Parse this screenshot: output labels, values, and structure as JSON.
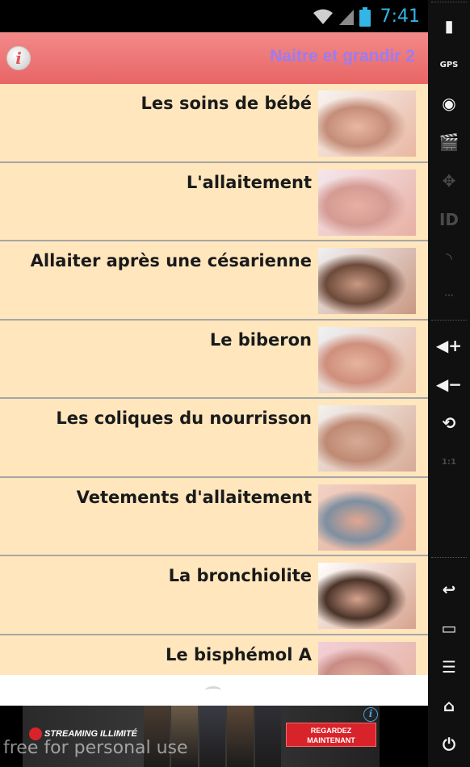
{
  "status_bar": {
    "time": "7:41"
  },
  "app_bar": {
    "title": "Naitre et grandir 2",
    "info_glyph": "i"
  },
  "list": {
    "items": [
      {
        "label": "Les soins de bébé",
        "thumb_colors": [
          "#f7f4f1",
          "#e9b7a2",
          "#c48d79"
        ]
      },
      {
        "label": "L'allaitement",
        "thumb_colors": [
          "#f4e7ee",
          "#e8b0a3",
          "#d49b93"
        ]
      },
      {
        "label": "Allaiter après une césarienne",
        "thumb_colors": [
          "#f0f0f2",
          "#c99883",
          "#6c4a3a"
        ]
      },
      {
        "label": "Le biberon",
        "thumb_colors": [
          "#eef2f6",
          "#e5b49d",
          "#cf8f7c"
        ]
      },
      {
        "label": "Les coliques du nourrisson",
        "thumb_colors": [
          "#f3f1ee",
          "#d7aa95",
          "#bf8a74"
        ]
      },
      {
        "label": "Vetements d'allaitement",
        "thumb_colors": [
          "#f1d2c4",
          "#e1a791",
          "#7e8fa1"
        ]
      },
      {
        "label": "La bronchiolite",
        "thumb_colors": [
          "#ffffff",
          "#d7a38e",
          "#4a3328"
        ]
      },
      {
        "label": "Le bisphémol A",
        "thumb_colors": [
          "#f3cfd8",
          "#e3b29f",
          "#c98c84"
        ]
      }
    ]
  },
  "ad": {
    "brand": "STREAMING ILLIMITÉ",
    "cta_line1": "REGARDEZ",
    "cta_line2": "MAINTENANT",
    "choice_glyph": "i",
    "watermark": "free for personal use",
    "poster_colors": [
      "#4a3b30",
      "#6b5a48",
      "#3b3b45",
      "#5a4636",
      "#2f2f36"
    ]
  },
  "emulator": {
    "buttons": [
      {
        "name": "battery-icon",
        "glyph": "▮"
      },
      {
        "name": "gps-icon",
        "glyph": "GPS"
      },
      {
        "name": "camera-icon",
        "glyph": "◉"
      },
      {
        "name": "video-icon",
        "glyph": "🎬"
      },
      {
        "name": "dpad-icon",
        "glyph": "✥"
      },
      {
        "name": "id-icon",
        "glyph": "ID"
      },
      {
        "name": "rss-icon",
        "glyph": "◝"
      },
      {
        "name": "sms-icon",
        "glyph": "···"
      },
      {
        "name": "volume-up-icon",
        "glyph": "◀+"
      },
      {
        "name": "volume-down-icon",
        "glyph": "◀−"
      },
      {
        "name": "rotate-icon",
        "glyph": "⟲"
      },
      {
        "name": "scale-icon",
        "glyph": "1:1"
      },
      {
        "name": "back-icon",
        "glyph": "↩"
      },
      {
        "name": "recents-icon",
        "glyph": "▭"
      },
      {
        "name": "menu-icon",
        "glyph": "☰"
      },
      {
        "name": "home-icon",
        "glyph": "⌂"
      },
      {
        "name": "power-icon",
        "glyph": "⏻"
      }
    ]
  }
}
